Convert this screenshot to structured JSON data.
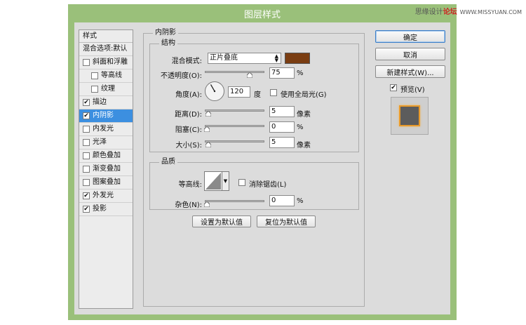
{
  "window": {
    "title": "图层样式"
  },
  "watermark": {
    "brand": "思缘设计",
    "badge": "论坛",
    "url": "WWW.MISSYUAN.COM"
  },
  "style_list": {
    "header": "样式",
    "items": [
      {
        "label": "混合选项:默认",
        "checkbox": false,
        "checked": false,
        "indent": 0,
        "selected": false
      },
      {
        "label": "斜面和浮雕",
        "checkbox": true,
        "checked": false,
        "indent": 0,
        "selected": false
      },
      {
        "label": "等高线",
        "checkbox": true,
        "checked": false,
        "indent": 1,
        "selected": false
      },
      {
        "label": "纹理",
        "checkbox": true,
        "checked": false,
        "indent": 1,
        "selected": false
      },
      {
        "label": "描边",
        "checkbox": true,
        "checked": true,
        "indent": 0,
        "selected": false
      },
      {
        "label": "内阴影",
        "checkbox": true,
        "checked": true,
        "indent": 0,
        "selected": true
      },
      {
        "label": "内发光",
        "checkbox": true,
        "checked": false,
        "indent": 0,
        "selected": false
      },
      {
        "label": "光泽",
        "checkbox": true,
        "checked": false,
        "indent": 0,
        "selected": false
      },
      {
        "label": "颜色叠加",
        "checkbox": true,
        "checked": false,
        "indent": 0,
        "selected": false
      },
      {
        "label": "渐变叠加",
        "checkbox": true,
        "checked": false,
        "indent": 0,
        "selected": false
      },
      {
        "label": "图案叠加",
        "checkbox": true,
        "checked": false,
        "indent": 0,
        "selected": false
      },
      {
        "label": "外发光",
        "checkbox": true,
        "checked": true,
        "indent": 0,
        "selected": false
      },
      {
        "label": "投影",
        "checkbox": true,
        "checked": true,
        "indent": 0,
        "selected": false
      }
    ]
  },
  "panel": {
    "title": "内阴影",
    "structure": {
      "title": "结构",
      "blend_mode_label": "混合模式:",
      "blend_mode_value": "正片叠底",
      "blend_color": "#7a3d12",
      "opacity_label": "不透明度(O):",
      "opacity_value": "75",
      "opacity_unit": "%",
      "opacity_fraction": 0.75,
      "angle_label": "角度(A):",
      "angle_value": "120",
      "angle_unit": "度",
      "global_light_label": "使用全局光(G)",
      "global_light_checked": false,
      "distance_label": "距离(D):",
      "distance_value": "5",
      "distance_unit": "像素",
      "choke_label": "阻塞(C):",
      "choke_value": "0",
      "choke_unit": "%",
      "size_label": "大小(S):",
      "size_value": "5",
      "size_unit": "像素"
    },
    "quality": {
      "title": "品质",
      "contour_label": "等高线:",
      "antialias_label": "消除锯齿(L)",
      "antialias_checked": false,
      "noise_label": "杂色(N):",
      "noise_value": "0",
      "noise_unit": "%"
    },
    "make_default": "设置为默认值",
    "reset_default": "复位为默认值"
  },
  "buttons": {
    "ok": "确定",
    "cancel": "取消",
    "new_style": "新建样式(W)...",
    "preview_label": "预览(V)",
    "preview_checked": true
  },
  "colors": {
    "frame": "#9ac07a",
    "selection": "#3c8fe0",
    "preview_border": "#e89a2a",
    "preview_fill": "#5c5c5c"
  }
}
